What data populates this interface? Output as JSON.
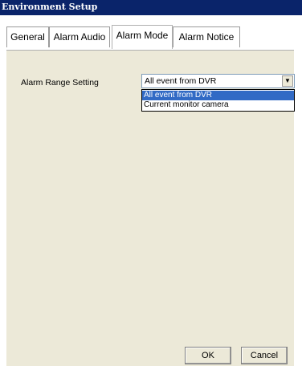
{
  "window": {
    "title": "Environment Setup"
  },
  "tabs": [
    {
      "label": "General"
    },
    {
      "label": "Alarm Audio"
    },
    {
      "label": "Alarm Mode"
    },
    {
      "label": "Alarm Notice"
    }
  ],
  "active_tab": "Alarm Mode",
  "alarm_range": {
    "label": "Alarm Range Setting",
    "selected": "All event from DVR",
    "options": [
      "All event from DVR",
      "Current monitor camera"
    ]
  },
  "buttons": {
    "ok": "OK",
    "cancel": "Cancel"
  },
  "colors": {
    "titlebar": "#0a246a",
    "selection": "#316ac5",
    "panel": "#ece9d8"
  }
}
